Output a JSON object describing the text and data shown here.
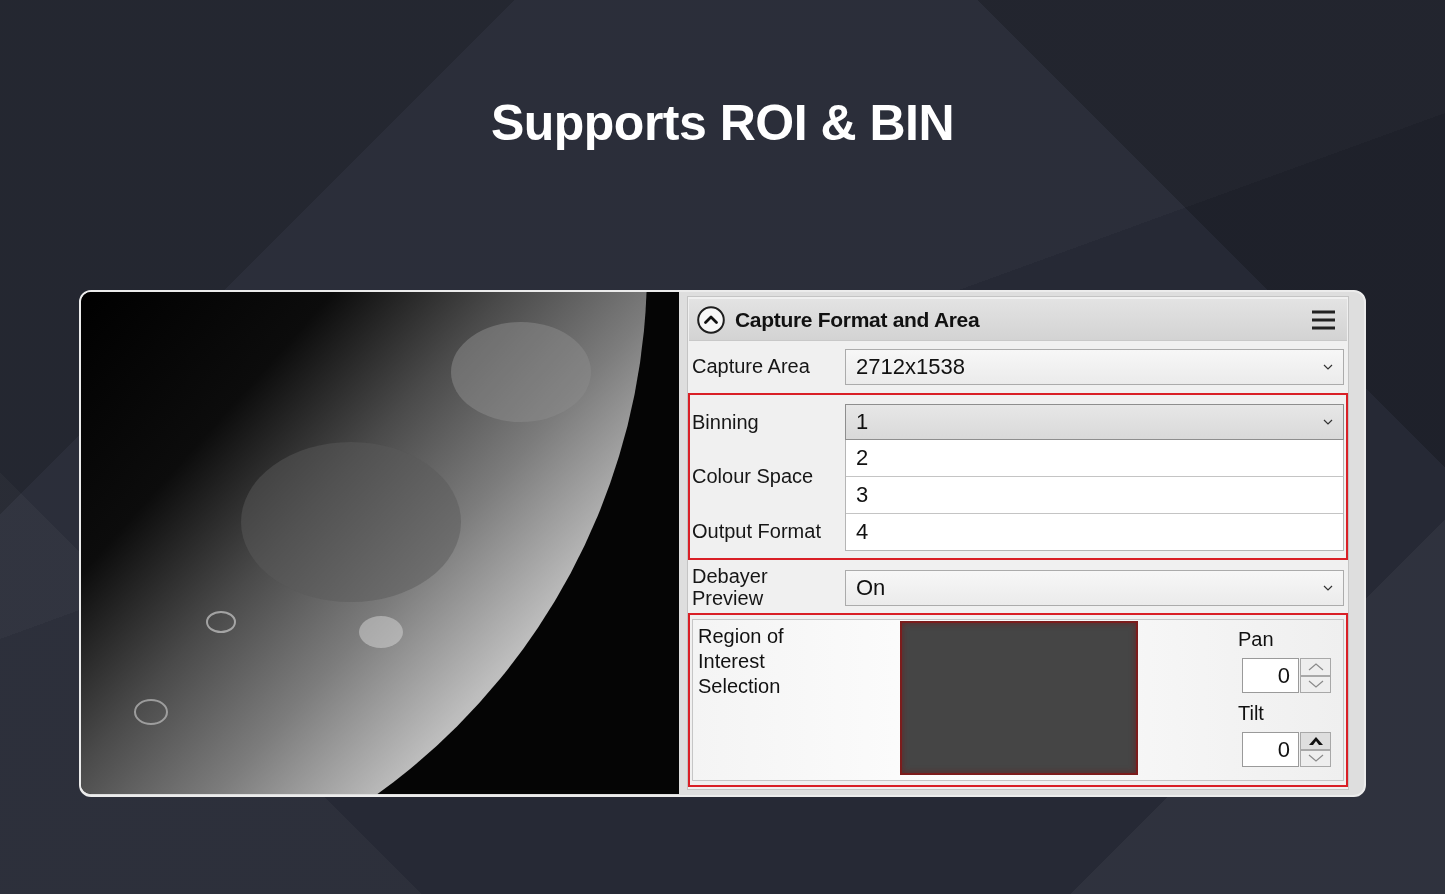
{
  "headline": "Supports ROI & BIN",
  "panel": {
    "title": "Capture Format and Area",
    "expanded": true,
    "sections": [
      {
        "kind": "fields",
        "highlighted": false,
        "rows": [
          {
            "label": "Capture Area",
            "value": "2712x1538",
            "expanded": false
          }
        ]
      },
      {
        "kind": "fields",
        "highlighted": true,
        "rows": [
          {
            "label": "Binning",
            "value": "1",
            "expanded": true,
            "options": [
              "2",
              "3",
              "4"
            ]
          },
          {
            "label": "Colour Space"
          },
          {
            "label": "Output Format"
          }
        ]
      },
      {
        "kind": "fields",
        "highlighted": false,
        "rows": [
          {
            "label": "Debayer Preview",
            "value": "On",
            "expanded": false
          }
        ]
      },
      {
        "kind": "roi",
        "highlighted": true,
        "label": "Region of Interest Selection",
        "spinners": [
          {
            "label": "Pan",
            "value": "0",
            "up_active": false
          },
          {
            "label": "Tilt",
            "value": "0",
            "up_active": true
          }
        ]
      }
    ]
  }
}
